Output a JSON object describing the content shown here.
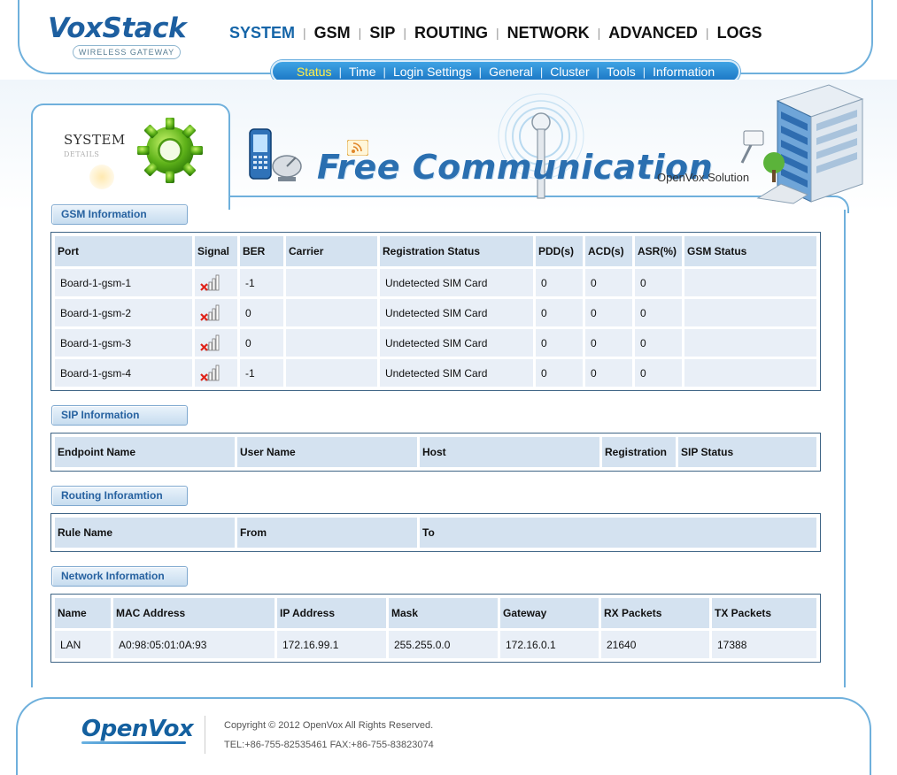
{
  "brand": {
    "name": "VoxStack",
    "tagline": "WIRELESS GATEWAY"
  },
  "mainnav": [
    {
      "label": "SYSTEM",
      "active": true
    },
    {
      "label": "GSM"
    },
    {
      "label": "SIP"
    },
    {
      "label": "ROUTING"
    },
    {
      "label": "NETWORK"
    },
    {
      "label": "ADVANCED"
    },
    {
      "label": "LOGS"
    }
  ],
  "subnav": [
    {
      "label": "Status",
      "active": true
    },
    {
      "label": "Time"
    },
    {
      "label": "Login Settings"
    },
    {
      "label": "General"
    },
    {
      "label": "Cluster"
    },
    {
      "label": "Tools"
    },
    {
      "label": "Information"
    }
  ],
  "banner": {
    "section_title": "SYSTEM",
    "section_sub": "DETAILS",
    "slogan": "Free Communication",
    "solution": "OpenVox Solution"
  },
  "gsm": {
    "title": "GSM Information",
    "headers": [
      "Port",
      "Signal",
      "BER",
      "Carrier",
      "Registration Status",
      "PDD(s)",
      "ACD(s)",
      "ASR(%)",
      "GSM Status"
    ],
    "rows": [
      [
        "Board-1-gsm-1",
        "",
        "-1",
        "",
        "Undetected SIM Card",
        "0",
        "0",
        "0",
        ""
      ],
      [
        "Board-1-gsm-2",
        "",
        "0",
        "",
        "Undetected SIM Card",
        "0",
        "0",
        "0",
        ""
      ],
      [
        "Board-1-gsm-3",
        "",
        "0",
        "",
        "Undetected SIM Card",
        "0",
        "0",
        "0",
        ""
      ],
      [
        "Board-1-gsm-4",
        "",
        "-1",
        "",
        "Undetected SIM Card",
        "0",
        "0",
        "0",
        ""
      ]
    ]
  },
  "sip": {
    "title": "SIP Information",
    "headers": [
      "Endpoint Name",
      "User Name",
      "Host",
      "Registration",
      "SIP Status"
    ]
  },
  "routing": {
    "title": "Routing Inforamtion",
    "headers": [
      "Rule Name",
      "From",
      "To"
    ]
  },
  "network": {
    "title": "Network Information",
    "headers": [
      "Name",
      "MAC Address",
      "IP Address",
      "Mask",
      "Gateway",
      "RX Packets",
      "TX Packets"
    ],
    "rows": [
      [
        "LAN",
        "A0:98:05:01:0A:93",
        "172.16.99.1",
        "255.255.0.0",
        "172.16.0.1",
        "21640",
        "17388"
      ]
    ]
  },
  "footer": {
    "logo": "OpenVox",
    "copyright": "Copyright © 2012 OpenVox All Rights Reserved.",
    "contact": "TEL:+86-755-82535461 FAX:+86-755-83823074"
  },
  "colors": {
    "accent": "#1565a8",
    "frame": "#6fb0dc",
    "header_cell": "#d4e2f0",
    "data_cell": "#e9eff7",
    "subnav_active": "#ffef4a"
  }
}
